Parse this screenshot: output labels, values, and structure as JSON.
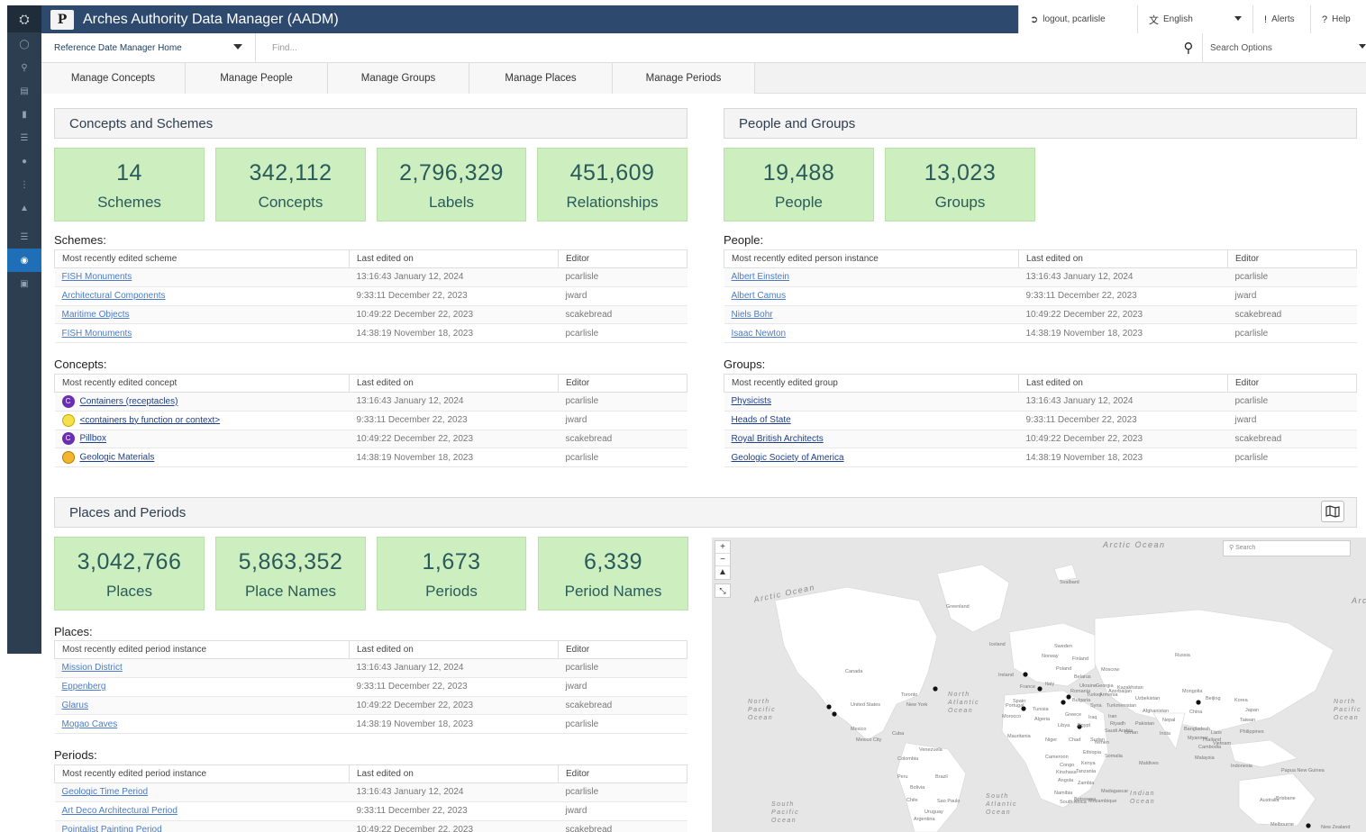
{
  "app": {
    "title": "Arches Authority Data Manager (AADM)",
    "logo_letter": "P"
  },
  "topbar": {
    "logout": "logout, pcarlisle",
    "language": "English",
    "alerts": "Alerts",
    "help": "Help"
  },
  "searchbar": {
    "home": "Reference Date Manager Home",
    "find_placeholder": "Find...",
    "search_options": "Search Options"
  },
  "tabs": [
    "Manage Concepts",
    "Manage People",
    "Manage Groups",
    "Manage Places",
    "Manage Periods"
  ],
  "concepts_section": {
    "title": "Concepts and Schemes",
    "tiles": [
      {
        "value": "14",
        "label": "Schemes"
      },
      {
        "value": "342,112",
        "label": "Concepts"
      },
      {
        "value": "2,796,329",
        "label": "Labels"
      },
      {
        "value": "451,609",
        "label": "Relationships"
      }
    ],
    "schemes": {
      "label": "Schemes:",
      "headers": [
        "Most recently edited scheme",
        "Last edited on",
        "Editor"
      ],
      "rows": [
        [
          "FISH Monuments",
          "13:16:43 January 12, 2024",
          "pcarlisle"
        ],
        [
          "Architectural Components",
          "9:33:11 December 22, 2023",
          "jward"
        ],
        [
          "Maritime Objects",
          "10:49:22 December 22, 2023",
          "scakebread"
        ],
        [
          "FISH Monuments",
          "14:38:19 November 18, 2023",
          "pcarlisle"
        ]
      ]
    },
    "concepts": {
      "label": "Concepts:",
      "headers": [
        "Most recently edited concept",
        "Last edited on",
        "Editor"
      ],
      "rows": [
        [
          "Containers (receptacles)",
          "13:16:43 January 12, 2024",
          "pcarlisle"
        ],
        [
          "<containers by function or context>",
          "9:33:11 December 22, 2023",
          "jward"
        ],
        [
          "Pillbox",
          "10:49:22 December 22, 2023",
          "scakebread"
        ],
        [
          "Geologic Materials",
          "14:38:19 November 18, 2023",
          "pcarlisle"
        ]
      ],
      "badges": [
        "C",
        "",
        "C",
        ""
      ]
    }
  },
  "people_section": {
    "title": "People and Groups",
    "tiles": [
      {
        "value": "19,488",
        "label": "People"
      },
      {
        "value": "13,023",
        "label": "Groups"
      }
    ],
    "people": {
      "label": "People:",
      "headers": [
        "Most recently edited person instance",
        "Last edited on",
        "Editor"
      ],
      "rows": [
        [
          "Albert Einstein",
          "13:16:43 January 12, 2024",
          "pcarlisle"
        ],
        [
          "Albert Camus",
          "9:33:11 December 22, 2023",
          "jward"
        ],
        [
          "Niels Bohr",
          "10:49:22 December 22, 2023",
          "scakebread"
        ],
        [
          "Isaac Newton",
          "14:38:19 November 18, 2023",
          "pcarlisle"
        ]
      ]
    },
    "groups": {
      "label": "Groups:",
      "headers": [
        "Most recently edited group",
        "Last edited on",
        "Editor"
      ],
      "rows": [
        [
          "Physicists",
          "13:16:43 January 12, 2024",
          "pcarlisle"
        ],
        [
          "Heads of State",
          "9:33:11 December 22, 2023",
          "jward"
        ],
        [
          "Royal British Architects",
          "10:49:22 December 22, 2023",
          "scakebread"
        ],
        [
          "Geologic Society of America",
          "14:38:19 November 18, 2023",
          "pcarlisle"
        ]
      ]
    }
  },
  "places_section": {
    "title": "Places and Periods",
    "tiles": [
      {
        "value": "3,042,766",
        "label": "Places"
      },
      {
        "value": "5,863,352",
        "label": "Place Names"
      },
      {
        "value": "1,673",
        "label": "Periods"
      },
      {
        "value": "6,339",
        "label": "Period Names"
      }
    ],
    "places": {
      "label": "Places:",
      "headers": [
        "Most recently edited period instance",
        "Last edited on",
        "Editor"
      ],
      "rows": [
        [
          "Mission District",
          "13:16:43 January 12, 2024",
          "pcarlisle"
        ],
        [
          "Eppenberg",
          "9:33:11 December 22, 2023",
          "jward"
        ],
        [
          "Glarus",
          "10:49:22 December 22, 2023",
          "scakebread"
        ],
        [
          "Mogao Caves",
          "14:38:19 November 18, 2023",
          "pcarlisle"
        ]
      ]
    },
    "periods": {
      "label": "Periods:",
      "headers": [
        "Most recently edited period instance",
        "Last edited on",
        "Editor"
      ],
      "rows": [
        [
          "Geologic Time Period",
          "13:16:43 January 12, 2024",
          "pcarlisle"
        ],
        [
          "Art Deco Architectural Period",
          "9:33:11 December 22, 2023",
          "jward"
        ],
        [
          "Pointalist Painting Period",
          "10:49:22 December 22, 2023",
          "scakebread"
        ]
      ]
    }
  },
  "map": {
    "search_placeholder": "Search",
    "oceans": [
      "Arctic Ocean",
      "Arctic Ocean",
      "North Pacific Ocean",
      "North Atlantic Ocean",
      "South Pacific Ocean",
      "South Atlantic Ocean",
      "Indian Ocean",
      "North Pacific Ocean",
      "Arc"
    ],
    "labels": [
      "Greenland",
      "Canada",
      "United States",
      "Russia",
      "Mongolia",
      "China",
      "Japan",
      "Brazil",
      "Peru",
      "Bolivia",
      "Chile",
      "Australia",
      "Indonesia",
      "India",
      "Kazakhstan",
      "Turkmenistan",
      "Iran",
      "Iraq",
      "Egypt",
      "Libya",
      "Algeria",
      "Mauritania",
      "Niger",
      "Chad",
      "Sudan",
      "Ethiopia",
      "Kenya",
      "Tanzania",
      "Angola",
      "Namibia",
      "South Africa",
      "Madagascar",
      "France",
      "Spain",
      "Sweden",
      "Norway",
      "Finland",
      "Iceland",
      "Ukraine",
      "Belarus",
      "Moscow",
      "Svalbard",
      "Mexico",
      "Cuba",
      "Colombia",
      "Venezuela",
      "Pakistan",
      "Oman",
      "Yemen",
      "Cameroon",
      "Congo",
      "Uruguay",
      "Argentina",
      "Morocco",
      "Tunisia",
      "Italy",
      "Poland",
      "Turkey",
      "Syria",
      "Saudi Arabia",
      "Beijing",
      "Bangladesh",
      "Cambodia",
      "Malaysia",
      "Papua New Guinea",
      "Philippines",
      "Toronto",
      "New York",
      "Mexico City",
      "Sao Paulo",
      "Brisbane",
      "Melbourne",
      "New Zealand",
      "Maldives",
      "Riyadh",
      "Kinshasa",
      "Somalia",
      "Zambia",
      "Botswana",
      "Mozambique",
      "Portugal",
      "Ireland",
      "Greece",
      "Romania",
      "Bulgaria",
      "Georgia",
      "Armenia",
      "Azerbaijan",
      "Uzbekistan",
      "Afghanistan",
      "Nepal",
      "Myanmar",
      "Thailand",
      "Vietnam",
      "Laos",
      "Korea",
      "Taiwan"
    ]
  },
  "colors": {
    "topbar": "#2d4a6e",
    "rail": "#2d3e50",
    "tile_bg": "#cdeebf",
    "tile_text": "#2a5a5a",
    "link": "#4a7cc7"
  }
}
